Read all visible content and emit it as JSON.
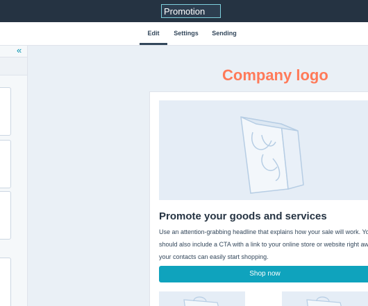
{
  "editor": {
    "email_name": "Promotion"
  },
  "tabs": [
    {
      "label": "Edit",
      "active": true
    },
    {
      "label": "Settings",
      "active": false
    },
    {
      "label": "Sending",
      "active": false
    }
  ],
  "sidebar": {
    "collapse_icon": "double-chevron-left-icon"
  },
  "email": {
    "logo_text": "Company logo",
    "hero_image_icon": "shopping-bag-icon",
    "headline": "Promote your goods and services",
    "body_lines": [
      "Use an attention-grabbing headline that explains how your sale will work. You",
      "should also include a CTA with a link to your online store or website right away so",
      "your contacts can easily start shopping."
    ],
    "cta_label": "Shop now"
  },
  "colors": {
    "topbar": "#253342",
    "logo": "#ff7a59",
    "cta": "#0fa3bd",
    "canvas": "#eaf0f6"
  }
}
